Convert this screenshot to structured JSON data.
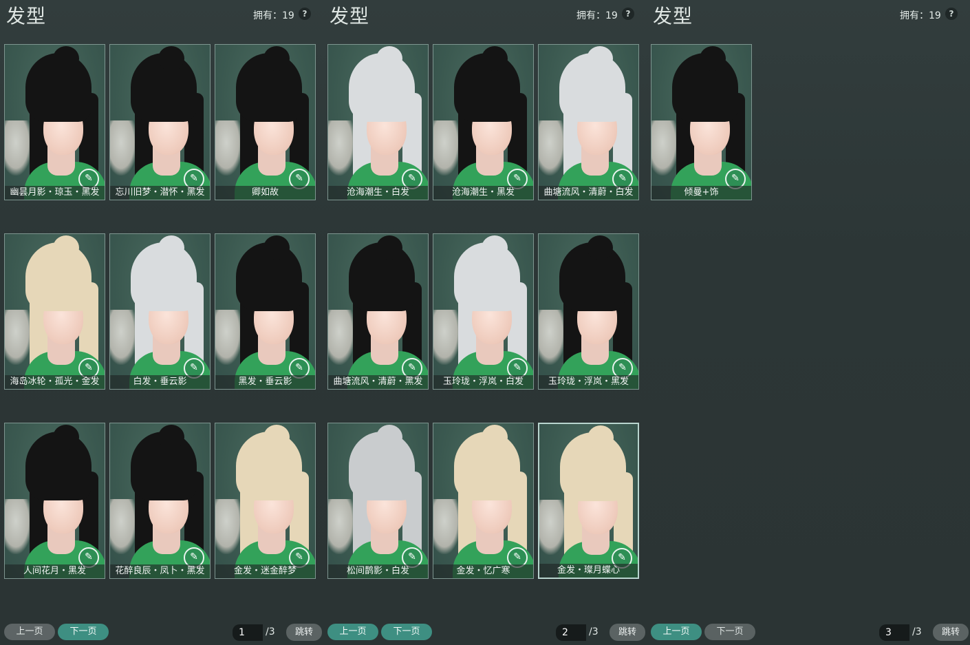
{
  "panels": [
    {
      "title": "发型",
      "owned": "拥有：19",
      "help": "?",
      "cards": [
        {
          "label": "幽昙月影・琼玉・黑发",
          "color": "black"
        },
        {
          "label": "忘川旧梦・潜怀・黑发",
          "color": "black"
        },
        {
          "label": "卿如故",
          "color": "black"
        },
        {
          "label": "海岛冰轮・孤光・金发",
          "color": "gold"
        },
        {
          "label": "白发・垂云影",
          "color": "white"
        },
        {
          "label": "黑发・垂云影",
          "color": "black"
        },
        {
          "label": "人间花月・黑发",
          "color": "black"
        },
        {
          "label": "花醉良辰・凤卜・黑发",
          "color": "black"
        },
        {
          "label": "金发・迷金醉梦",
          "color": "gold"
        }
      ],
      "prev_label": "上一页",
      "next_label": "下一页",
      "page_value": "1",
      "page_total": "/3",
      "jump_label": "跳转"
    },
    {
      "title": "发型",
      "owned": "拥有：19",
      "help": "?",
      "cards": [
        {
          "label": "沧海潮生・白发",
          "color": "white"
        },
        {
          "label": "沧海潮生・黑发",
          "color": "black"
        },
        {
          "label": "曲塘流风・清蔚・白发",
          "color": "white"
        },
        {
          "label": "曲塘流风・清蔚・黑发",
          "color": "black"
        },
        {
          "label": "玉玲珑・浮岚・白发",
          "color": "white"
        },
        {
          "label": "玉玲珑・浮岚・黑发",
          "color": "black"
        },
        {
          "label": "松间鹊影・白发",
          "color": "silver"
        },
        {
          "label": "金发・忆广寒",
          "color": "gold"
        },
        {
          "label": "金发・璨月蝶心",
          "color": "gold",
          "selected": true
        }
      ],
      "prev_label": "上一页",
      "next_label": "下一页",
      "page_value": "2",
      "page_total": "/3",
      "jump_label": "跳转"
    },
    {
      "title": "发型",
      "owned": "拥有：19",
      "help": "?",
      "cards": [
        {
          "label": "倾曼+饰",
          "color": "black"
        }
      ],
      "prev_label": "上一页",
      "next_label": "下一页",
      "page_value": "3",
      "page_total": "/3",
      "jump_label": "跳转"
    }
  ]
}
